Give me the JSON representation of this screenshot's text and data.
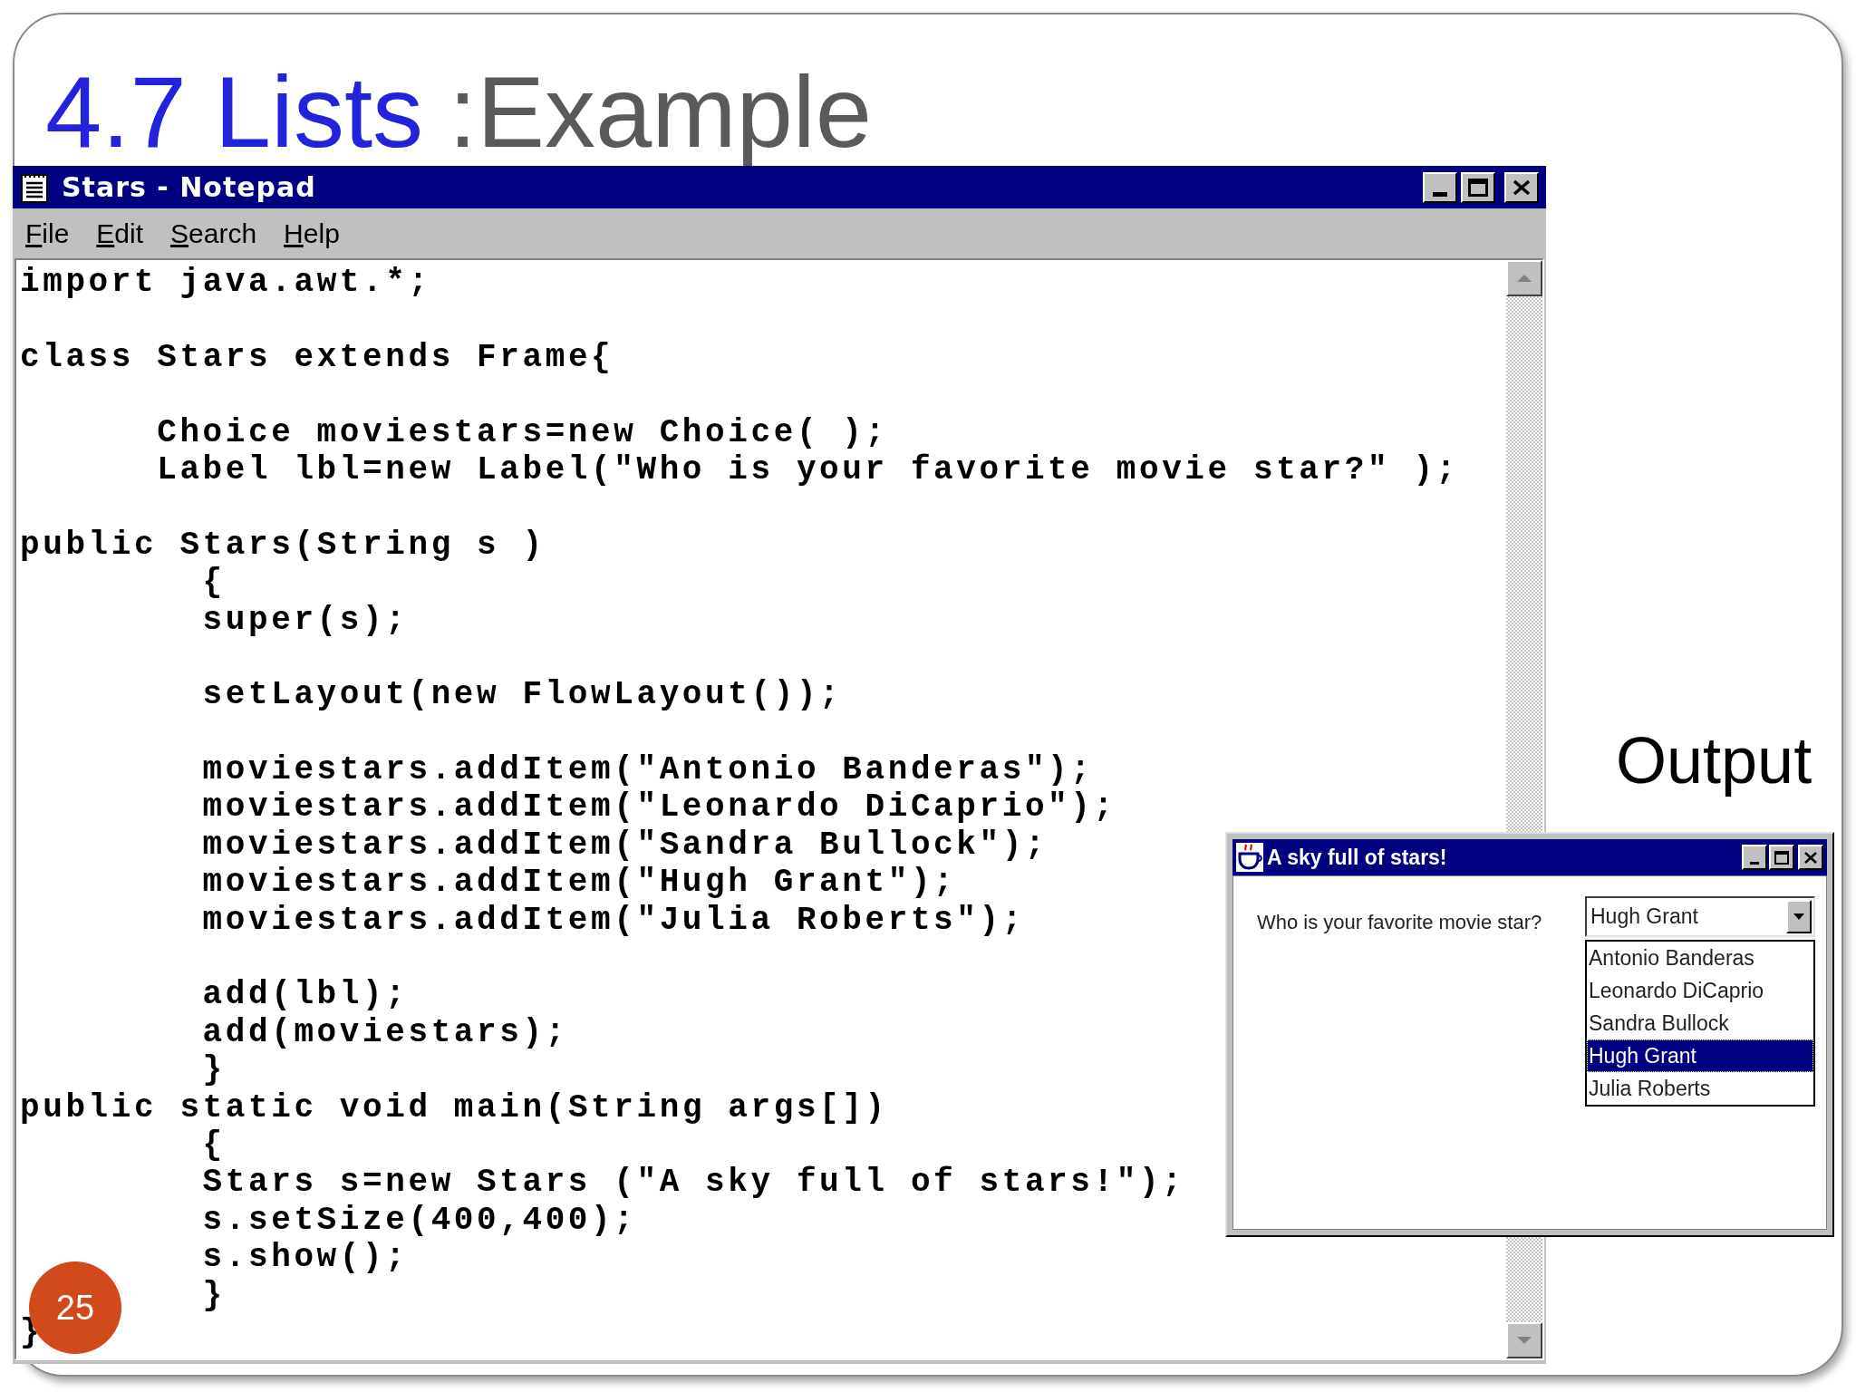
{
  "slide": {
    "title": {
      "main": "4.7 Lists",
      "sub": ":Example"
    },
    "caption": "Output",
    "page_number": "25"
  },
  "notepad": {
    "title": "Stars - Notepad",
    "menu": [
      "File",
      "Edit",
      "Search",
      "Help"
    ],
    "code": "import java.awt.*;\n\nclass Stars extends Frame{\n\n      Choice moviestars=new Choice( );\n      Label lbl=new Label(\"Who is your favorite movie star?\" );\n\npublic Stars(String s )\n        {\n        super(s);\n\n        setLayout(new FlowLayout());\n\n        moviestars.addItem(\"Antonio Banderas\");\n        moviestars.addItem(\"Leonardo DiCaprio\");\n        moviestars.addItem(\"Sandra Bullock\");\n        moviestars.addItem(\"Hugh Grant\");\n        moviestars.addItem(\"Julia Roberts\");\n\n        add(lbl);\n        add(moviestars);\n        }\npublic static void main(String args[])\n        {\n        Stars s=new Stars (\"A sky full of stars!\");\n        s.setSize(400,400);\n        s.show();\n        }\n}"
  },
  "output_window": {
    "title": "A sky full of stars!",
    "label": "Who is your favorite movie star?",
    "choice": {
      "value": "Hugh Grant",
      "options": [
        {
          "label": "Antonio Banderas",
          "selected": false
        },
        {
          "label": "Leonardo DiCaprio",
          "selected": false
        },
        {
          "label": "Sandra Bullock",
          "selected": false
        },
        {
          "label": "Hugh Grant",
          "selected": true
        },
        {
          "label": "Julia Roberts",
          "selected": false
        }
      ]
    }
  }
}
